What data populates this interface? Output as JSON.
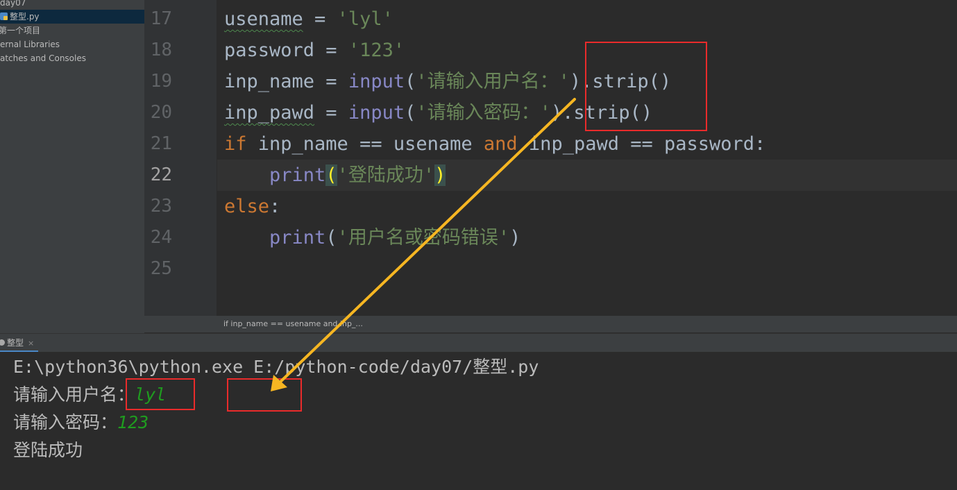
{
  "project_tree": {
    "items": [
      {
        "label": "day07"
      },
      {
        "label": "整型.py"
      },
      {
        "label": "第一个项目"
      },
      {
        "label": "ernal Libraries"
      },
      {
        "label": "atches and Consoles"
      }
    ]
  },
  "editor": {
    "line_numbers": [
      "17",
      "18",
      "19",
      "20",
      "21",
      "22",
      "23",
      "24",
      "25"
    ],
    "current_line": "22",
    "tokens": {
      "l17": {
        "var": "usename",
        "op": " = ",
        "str": "'lyl'"
      },
      "l18": {
        "var": "password",
        "op": " = ",
        "str": "'123'"
      },
      "l19": {
        "var": "inp_name",
        "op": " = ",
        "fn": "input",
        "open": "(",
        "str": "'请输入用户名：'",
        "tail": ").strip()"
      },
      "l20": {
        "var": "inp_pawd",
        "op": " = ",
        "fn": "input",
        "open": "(",
        "str": "'请输入密码：'",
        "tail": ").strip()"
      },
      "l21": {
        "kw_if": "if",
        "a": " inp_name == usename ",
        "kw_and": "and",
        "b": " inp_pawd == password:"
      },
      "l22": {
        "indent": "    ",
        "fn": "print",
        "open": "(",
        "str": "'登陆成功'",
        "close": ")"
      },
      "l23": {
        "kw": "else",
        "colon": ":"
      },
      "l24": {
        "indent": "    ",
        "fn": "print",
        "open": "(",
        "str": "'用户名或密码错误'",
        "close": ")"
      }
    },
    "breadcrumb": "if inp_name == usename and inp_..."
  },
  "run_panel": {
    "tab_label": "整型",
    "close_glyph": "×",
    "command": "E:\\python36\\python.exe E:/python-code/day07/整型.py",
    "prompt_user": "请输入用户名：",
    "input_user": "lyl",
    "prompt_pass": "请输入密码：",
    "input_pass": "123",
    "result": "登陆成功"
  },
  "annotation": {
    "box_color": "#ea2b2b",
    "arrow_color": "#f6b622"
  },
  "colors": {
    "keyword": "#cc7832",
    "builtin": "#8888c6",
    "string": "#6a8759",
    "console_input": "#1f9c1f"
  }
}
